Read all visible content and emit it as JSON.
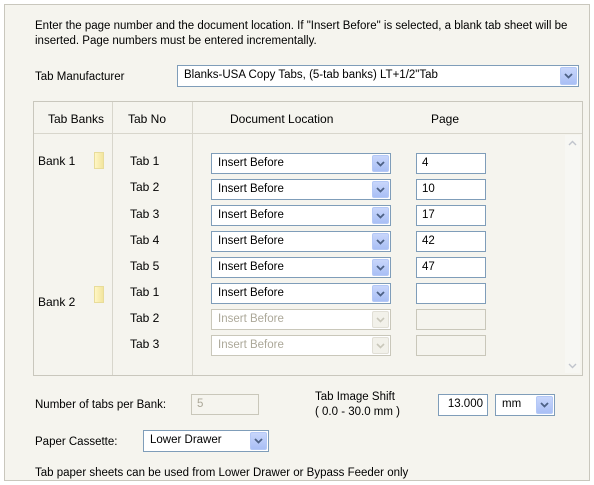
{
  "intro_text": "Enter the page number and the document location. If \"Insert Before\" is selected, a blank tab sheet will be inserted. Page numbers must be entered  incrementally.",
  "tab_manufacturer": {
    "label": "Tab Manufacturer",
    "value": "Blanks-USA Copy Tabs, (5-tab banks) LT+1/2\"Tab"
  },
  "table": {
    "headers": {
      "tab_banks": "Tab Banks",
      "tab_no": "Tab No",
      "document_location": "Document Location",
      "page": "Page"
    },
    "banks": [
      "Bank 1",
      "Bank 2"
    ],
    "rows": [
      {
        "tab": "Tab 1",
        "location": "Insert Before",
        "page": "4",
        "enabled": true
      },
      {
        "tab": "Tab 2",
        "location": "Insert Before",
        "page": "10",
        "enabled": true
      },
      {
        "tab": "Tab 3",
        "location": "Insert Before",
        "page": "17",
        "enabled": true
      },
      {
        "tab": "Tab 4",
        "location": "Insert Before",
        "page": "42",
        "enabled": true
      },
      {
        "tab": "Tab 5",
        "location": "Insert Before",
        "page": "47",
        "enabled": true
      },
      {
        "tab": "Tab 1",
        "location": "Insert Before",
        "page": "",
        "enabled": true
      },
      {
        "tab": "Tab 2",
        "location": "Insert Before",
        "page": "",
        "enabled": false
      },
      {
        "tab": "Tab 3",
        "location": "Insert Before",
        "page": "",
        "enabled": false
      }
    ]
  },
  "tabs_per_bank": {
    "label": "Number of tabs per Bank:",
    "value": "5"
  },
  "tab_image_shift": {
    "label": "Tab Image Shift",
    "range": "( 0.0 - 30.0 mm )",
    "value": "13.000",
    "unit": "mm"
  },
  "paper_cassette": {
    "label": "Paper Cassette:",
    "value": "Lower Drawer"
  },
  "footer_note": "Tab paper sheets can be used from Lower Drawer or Bypass Feeder only",
  "colors": {
    "panel_bg": "#f5f4ee",
    "field_border": "#7f9db9",
    "dropdown_button": "#b4c8f6",
    "disabled_text": "#aca899"
  }
}
